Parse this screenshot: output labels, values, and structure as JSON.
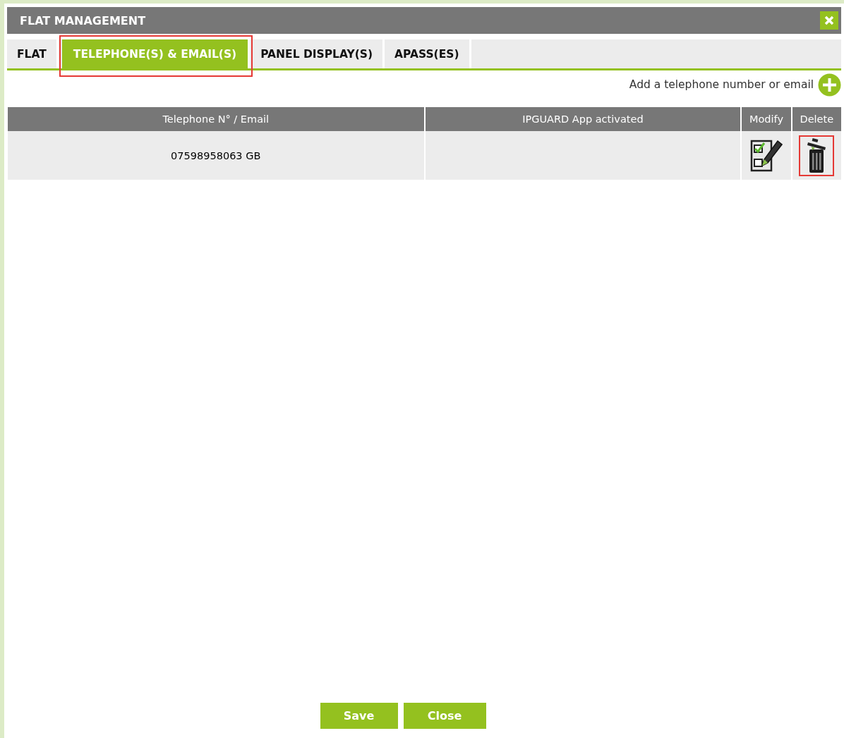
{
  "window": {
    "title": "FLAT MANAGEMENT"
  },
  "tabs": [
    {
      "label": "FLAT",
      "selected": false,
      "highlighted": false
    },
    {
      "label": "TELEPHONE(S) & EMAIL(S)",
      "selected": true,
      "highlighted": true
    },
    {
      "label": "PANEL DISPLAY(S)",
      "selected": false,
      "highlighted": false
    },
    {
      "label": "APASS(ES)",
      "selected": false,
      "highlighted": false
    }
  ],
  "add_link": {
    "label": "Add a telephone number or email"
  },
  "table": {
    "columns": [
      "Telephone N° / Email",
      "IPGUARD App activated",
      "Modify",
      "Delete"
    ],
    "rows": [
      {
        "number": "07598958063 GB",
        "actions": [
          {
            "kind": "modify",
            "highlighted": false
          },
          {
            "kind": "delete",
            "highlighted": true
          }
        ]
      }
    ]
  },
  "buttons": [
    "Save",
    "Close"
  ]
}
